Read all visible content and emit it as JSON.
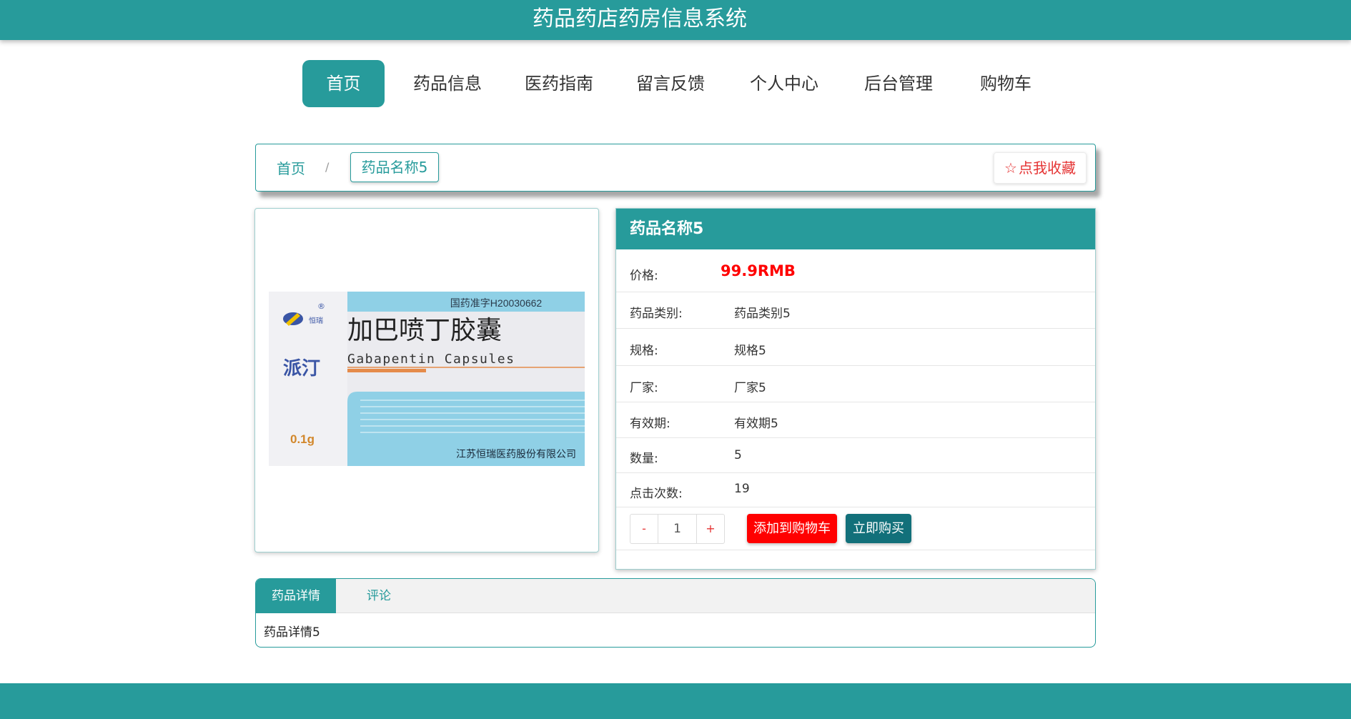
{
  "header": {
    "title": "药品药店药房信息系统"
  },
  "nav": {
    "items": [
      {
        "label": "首页",
        "active": true
      },
      {
        "label": "药品信息",
        "active": false
      },
      {
        "label": "医药指南",
        "active": false
      },
      {
        "label": "留言反馈",
        "active": false
      },
      {
        "label": "个人中心",
        "active": false
      },
      {
        "label": "后台管理",
        "active": false
      },
      {
        "label": "购物车",
        "active": false
      }
    ]
  },
  "breadcrumb": {
    "home": "首页",
    "separator": "/",
    "current": "药品名称5",
    "favorite_label": "点我收藏",
    "favorite_icon": "star-outline-icon"
  },
  "product": {
    "image": {
      "approval": "国药准字H20030662",
      "brand_cn": "派汀",
      "brand_mark": "恒瑞",
      "name_cn": "加巴喷丁胶囊",
      "name_en": "Gabapentin Capsules",
      "dose": "0.1g",
      "company": "江苏恒瑞医药股份有限公司",
      "registered_mark": "®"
    },
    "name": "药品名称5",
    "price_label": "价格:",
    "price": "99.9RMB",
    "fields": [
      {
        "label": "药品类别:",
        "value": "药品类别5"
      },
      {
        "label": "规格:",
        "value": "规格5"
      },
      {
        "label": "厂家:",
        "value": "厂家5"
      },
      {
        "label": "有效期:",
        "value": "有效期5"
      },
      {
        "label": "数量:",
        "value": "5"
      },
      {
        "label": "点击次数:",
        "value": "19"
      }
    ],
    "quantity": {
      "minus": "-",
      "value": "1",
      "plus": "+"
    },
    "add_to_cart": "添加到购物车",
    "buy_now": "立即购买"
  },
  "tabs": {
    "items": [
      {
        "label": "药品详情"
      },
      {
        "label": "评论"
      }
    ],
    "content": "药品详情5"
  },
  "colors": {
    "primary": "#279b9b",
    "price": "#ff0000",
    "buy": "#12707a"
  }
}
